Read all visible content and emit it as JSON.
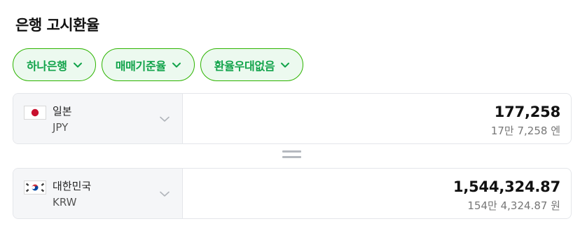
{
  "title": "은행 고시환율",
  "filters": [
    {
      "label": "하나은행"
    },
    {
      "label": "매매기준율"
    },
    {
      "label": "환율우대없음"
    }
  ],
  "from": {
    "flag_icon": "japan-flag-icon",
    "name": "일본",
    "code": "JPY",
    "amount": "177,258",
    "amount_read": "17만 7,258 엔"
  },
  "to": {
    "flag_icon": "korea-flag-icon",
    "name": "대한민국",
    "code": "KRW",
    "amount": "1,544,324.87",
    "amount_read": "154만 4,324.87 원"
  },
  "colors": {
    "accent": "#11a34a",
    "chip_border": "#2db400",
    "chip_bg": "#ecf9ef"
  }
}
